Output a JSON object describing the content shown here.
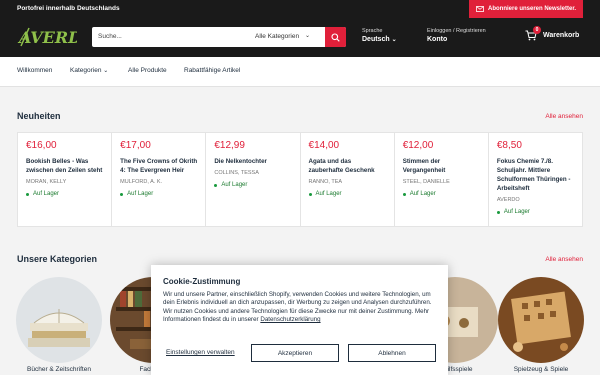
{
  "topbar": {
    "shipping": "Portofrei innerhalb Deutschlands",
    "newsletter": "Abonniere unseren Newsletter."
  },
  "header": {
    "logo_text": "AVERDO",
    "search_placeholder": "Suche...",
    "search_category": "Alle Kategorien",
    "language_label": "Sprache",
    "language_value": "Deutsch",
    "account_label": "Einloggen / Registrieren",
    "account_value": "Konto",
    "cart_label": "Warenkorb",
    "cart_count": "0"
  },
  "nav": {
    "items": [
      "Willkommen",
      "Kategorien",
      "Alle Produkte",
      "Rabattfähige Artikel"
    ]
  },
  "new_section": {
    "title": "Neuheiten",
    "see_all": "Alle ansehen",
    "products": [
      {
        "price": "€16,00",
        "title": "Bookish Belles - Was zwischen den Zeilen steht",
        "author": "MORAN, KELLY",
        "stock": "Auf Lager"
      },
      {
        "price": "€17,00",
        "title": "The Five Crowns of Okrith 4: The Evergreen Heir",
        "author": "MULFORD, A. K.",
        "stock": "Auf Lager"
      },
      {
        "price": "€12,99",
        "title": "Die Nelkentochter",
        "author": "COLLINS, TESSA",
        "stock": "Auf Lager"
      },
      {
        "price": "€14,00",
        "title": "Agata und das zauberhafte Geschenk",
        "author": "RANNO, TEA",
        "stock": "Auf Lager"
      },
      {
        "price": "€12,00",
        "title": "Stimmen der Vergangenheit",
        "author": "STEEL, DANIELLE",
        "stock": "Auf Lager"
      },
      {
        "price": "€8,50",
        "title": "Fokus Chemie 7./8. Schuljahr. Mittlere Schulformen Thüringen - Arbeitsheft",
        "author": "AVERDO",
        "stock": "Auf Lager"
      }
    ]
  },
  "categories_section": {
    "title": "Unsere Kategorien",
    "see_all": "Alle ansehen",
    "items": [
      "Bücher & Zeitschriften",
      "Fachbü...",
      "",
      "",
      "...Hilfsspiele",
      "Spielzeug & Spiele"
    ]
  },
  "cookie": {
    "title": "Cookie-Zustimmung",
    "text": "Wir und unsere Partner, einschließlich Shopify, verwenden Cookies und weitere Technologien, um dein Erlebnis individuell an dich anzupassen, dir Werbung zu zeigen und Analysen durchzuführen. Wir nutzen Cookies und andere Technologien für diese Zwecke nur mit deiner Zustimmung. Mehr Informationen findest du in unserer",
    "link": "Datenschutzerklärung",
    "settings": "Einstellungen verwalten",
    "accept": "Akzeptieren",
    "decline": "Ablehnen"
  },
  "colors": {
    "accent": "#e0203a",
    "dark": "#1a1a1a",
    "text": "#1e2d3d",
    "stock": "#1a9a3e"
  }
}
